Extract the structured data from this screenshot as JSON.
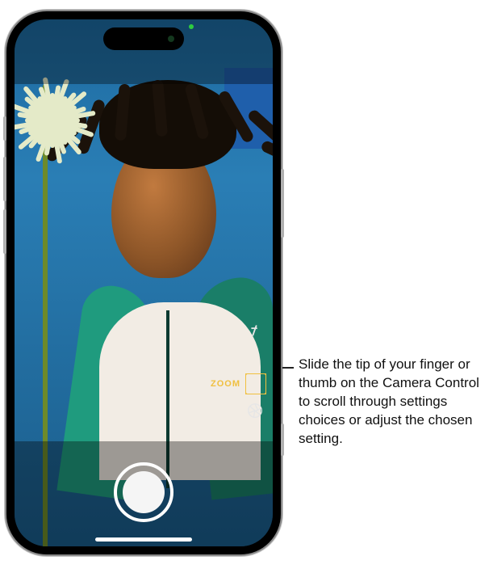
{
  "camera": {
    "zoom_label": "ZOOM",
    "settings": [
      {
        "key": "exposure",
        "icon": "f-icon"
      },
      {
        "key": "zoom",
        "icon": "frame-icon",
        "active": true
      },
      {
        "key": "style",
        "icon": "aperture-icon"
      }
    ]
  },
  "callout": {
    "text": "Slide the tip of your finger or thumb on the Camera Control to scroll through settings choices or adjust the chosen setting."
  },
  "colors": {
    "accent_yellow": "#f0c040"
  }
}
